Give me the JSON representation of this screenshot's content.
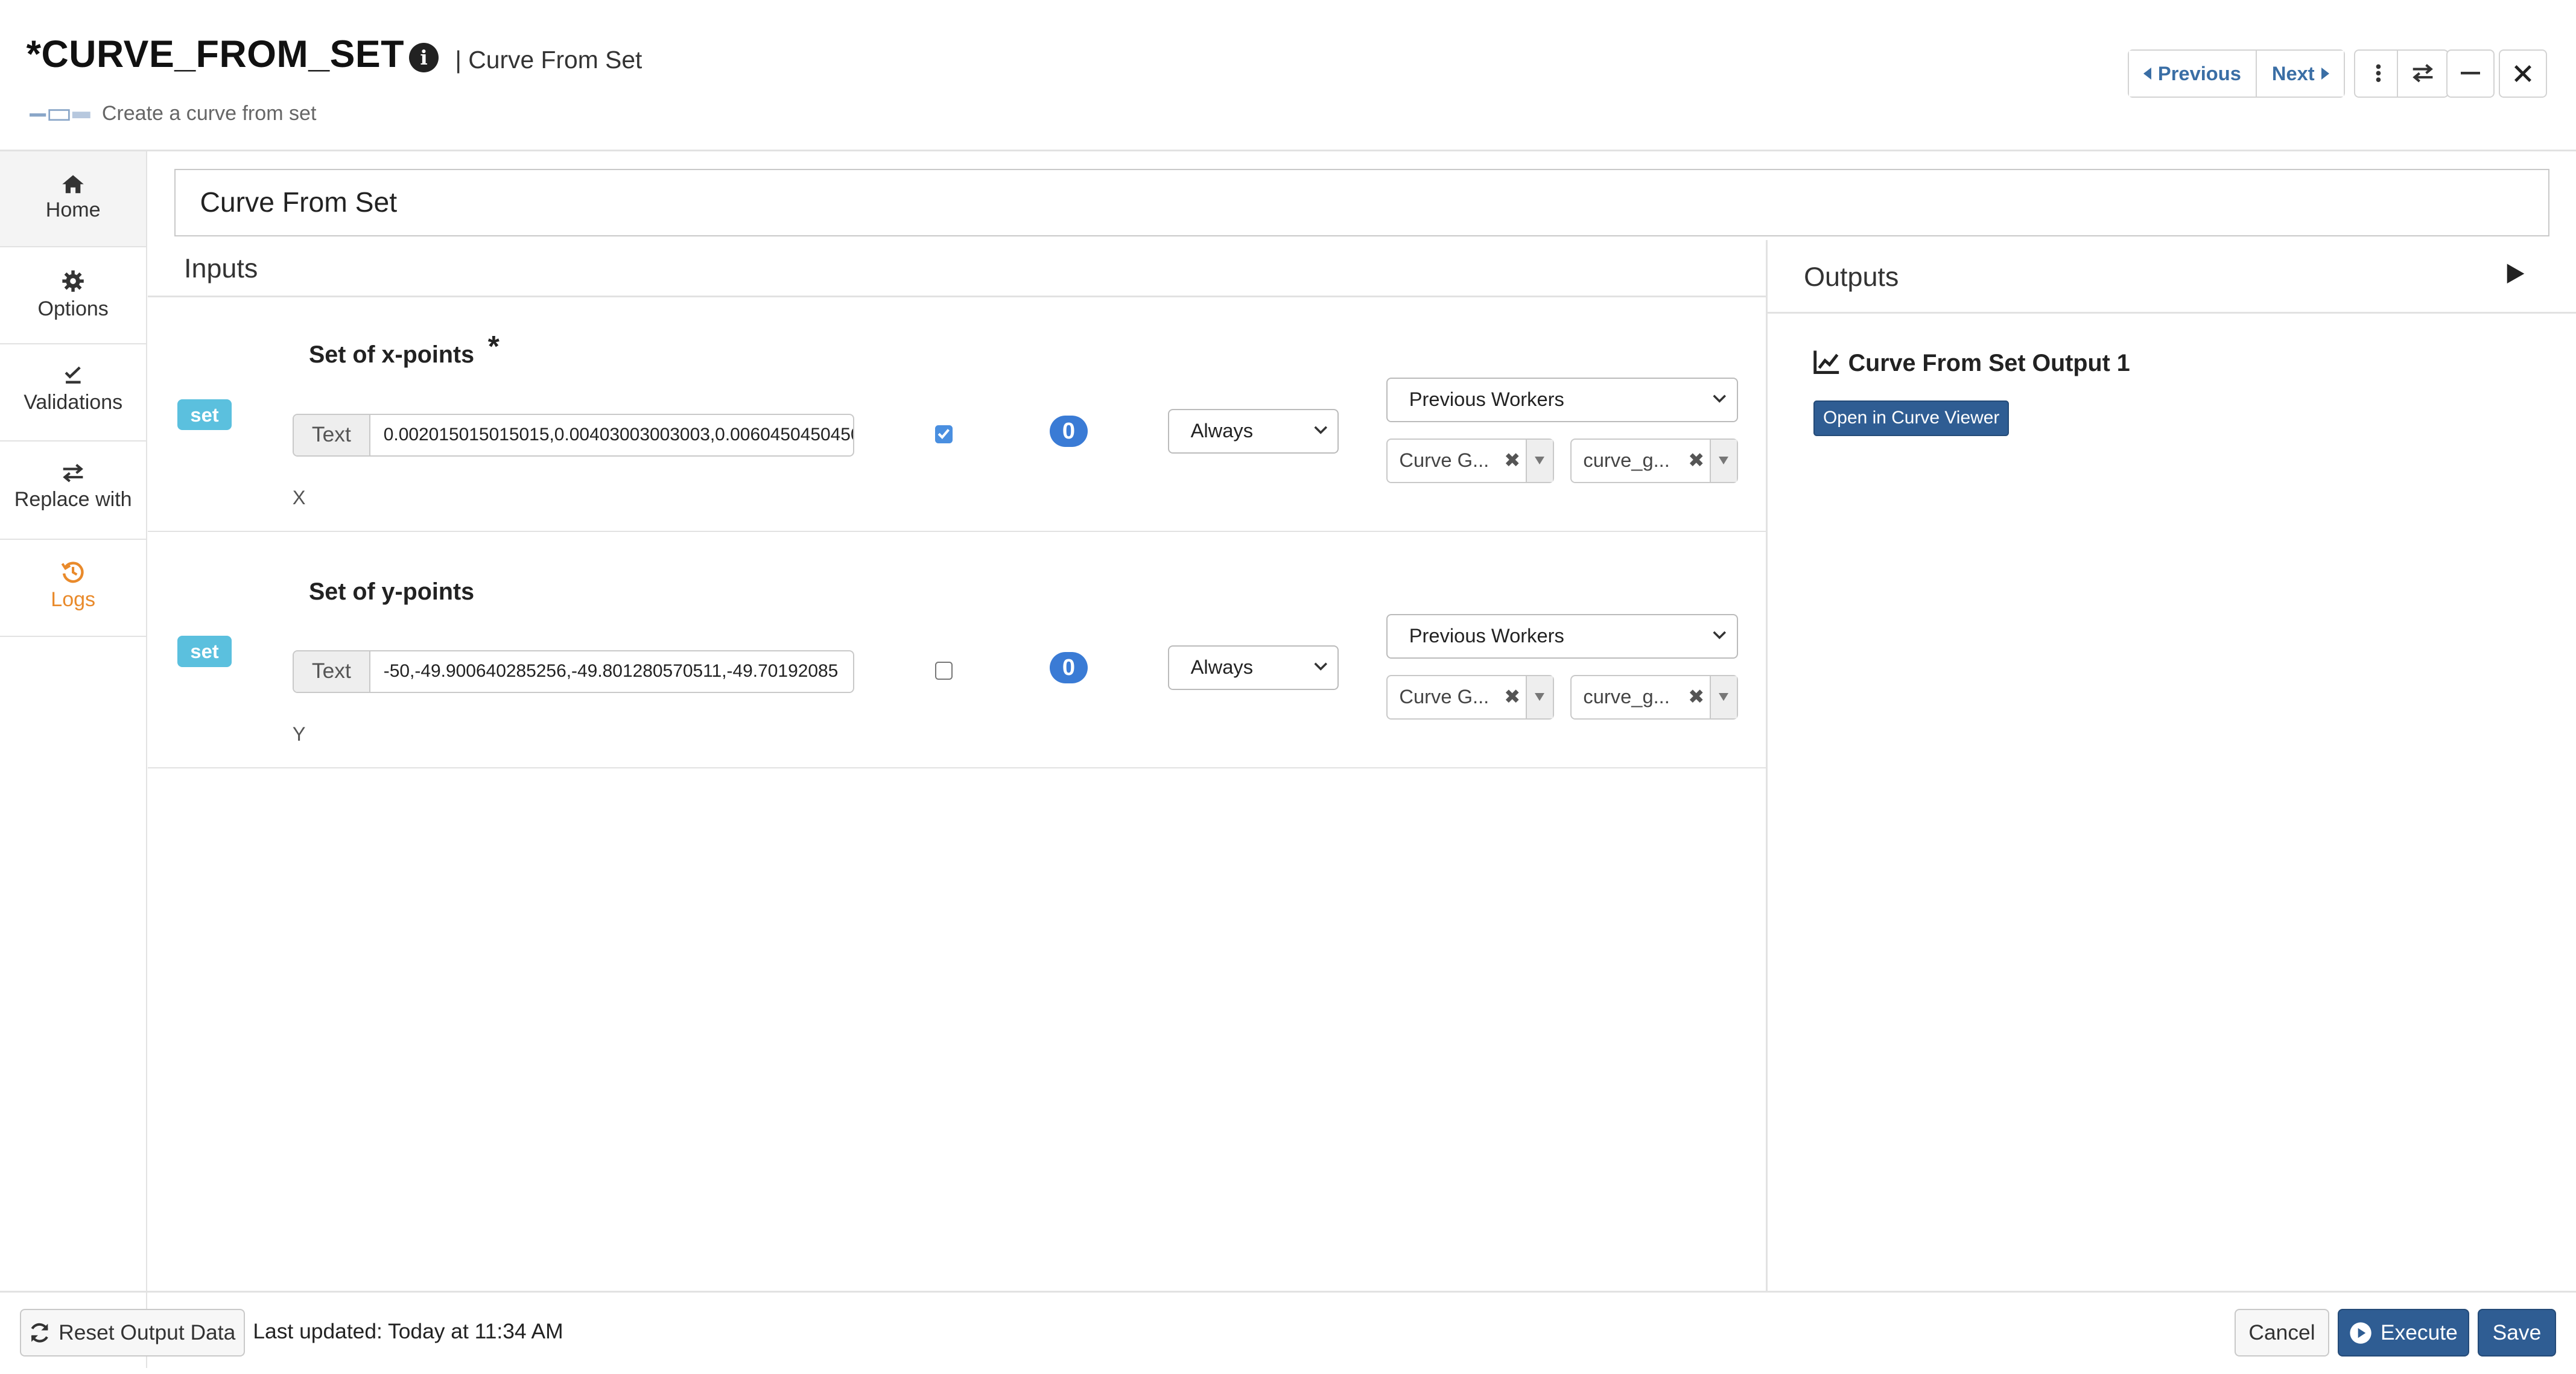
{
  "header": {
    "title": "*CURVE_FROM_SET",
    "subtitle": "| Curve From Set",
    "description": "Create a curve from set",
    "previous_label": "Previous",
    "next_label": "Next"
  },
  "sidebar": {
    "items": [
      {
        "label": "Home",
        "icon": "home-icon"
      },
      {
        "label": "Options",
        "icon": "gear-icon"
      },
      {
        "label": "Validations",
        "icon": "check-list-icon"
      },
      {
        "label": "Replace with",
        "icon": "exchange-icon"
      },
      {
        "label": "Logs",
        "icon": "history-icon",
        "color": "#e98a2b"
      }
    ]
  },
  "worker": {
    "name": "Curve From Set"
  },
  "inputs": {
    "heading": "Inputs",
    "params": [
      {
        "type_badge": "set",
        "title": "Set of x-points",
        "required_mark": "*",
        "addon": "Text",
        "value": "0.002015015015015,0.00403003003003,0.0060450450450",
        "checked": true,
        "count": "0",
        "mode": "Always",
        "source": "Previous Workers",
        "tag1": "Curve G...",
        "tag2": "curve_g...",
        "sub_label": "X"
      },
      {
        "type_badge": "set",
        "title": "Set of y-points",
        "required_mark": "",
        "addon": "Text",
        "value": "-50,-49.900640285256,-49.801280570511,-49.70192085",
        "checked": false,
        "count": "0",
        "mode": "Always",
        "source": "Previous Workers",
        "tag1": "Curve G...",
        "tag2": "curve_g...",
        "sub_label": "Y"
      }
    ]
  },
  "outputs": {
    "heading": "Outputs",
    "items": [
      {
        "title": "Curve From Set Output 1",
        "button": "Open in Curve Viewer",
        "icon": "line-chart-icon"
      }
    ]
  },
  "footer": {
    "reset_label": "Reset Output Data",
    "last_updated": "Last updated: Today at 11:34 AM",
    "cancel_label": "Cancel",
    "execute_label": "Execute",
    "save_label": "Save"
  },
  "colors": {
    "accent": "#2f5d93",
    "badge": "#5bc0de",
    "count_badge": "#3a7bd5",
    "logs": "#e98a2b"
  }
}
